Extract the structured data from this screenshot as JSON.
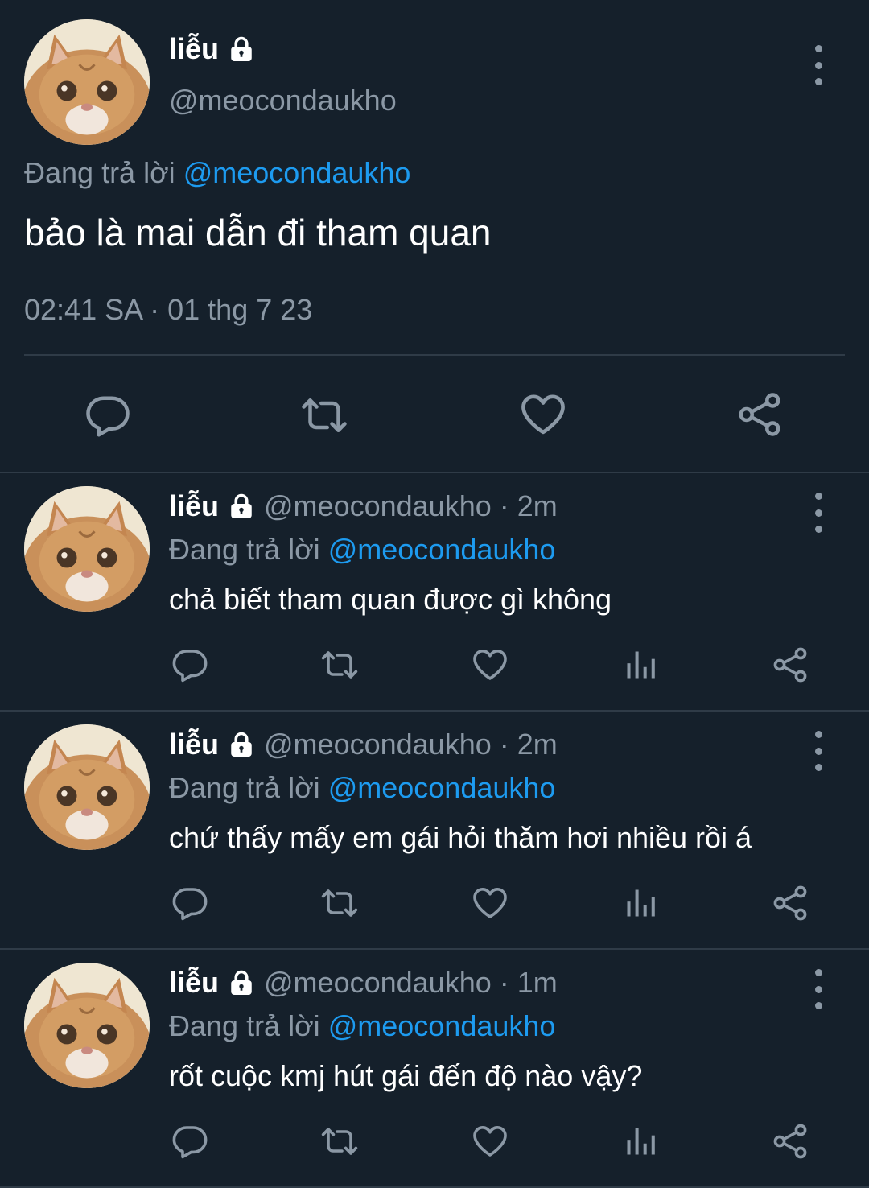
{
  "colors": {
    "background": "#15202b",
    "muted": "#8b98a5",
    "accent": "#1d9bf0",
    "divider": "#2f3b47"
  },
  "main_tweet": {
    "name": "liễu",
    "handle": "@meocondaukho",
    "replying_prefix": "Đang trả lời",
    "replying_to": "@meocondaukho",
    "text": "bảo là mai dẫn đi tham quan",
    "timestamp": "02:41 SA · 01 thg 7 23",
    "icons": [
      "reply-icon",
      "retweet-icon",
      "like-icon",
      "share-icon"
    ]
  },
  "replies": [
    {
      "name": "liễu",
      "handle": "@meocondaukho",
      "time": "· 2m",
      "replying_prefix": "Đang trả lời",
      "replying_to": "@meocondaukho",
      "text": "chả biết tham quan được gì không"
    },
    {
      "name": "liễu",
      "handle": "@meocondaukho",
      "time": "· 2m",
      "replying_prefix": "Đang trả lời",
      "replying_to": "@meocondaukho",
      "text": "chứ thấy mấy em gái hỏi thăm hơi nhiều rồi á"
    },
    {
      "name": "liễu",
      "handle": "@meocondaukho",
      "time": "· 1m",
      "replying_prefix": "Đang trả lời",
      "replying_to": "@meocondaukho",
      "text": "rốt cuộc kmj hút gái đến độ nào vậy?"
    }
  ],
  "reply_action_icons": [
    "reply-icon",
    "retweet-icon",
    "like-icon",
    "analytics-icon",
    "share-icon"
  ]
}
